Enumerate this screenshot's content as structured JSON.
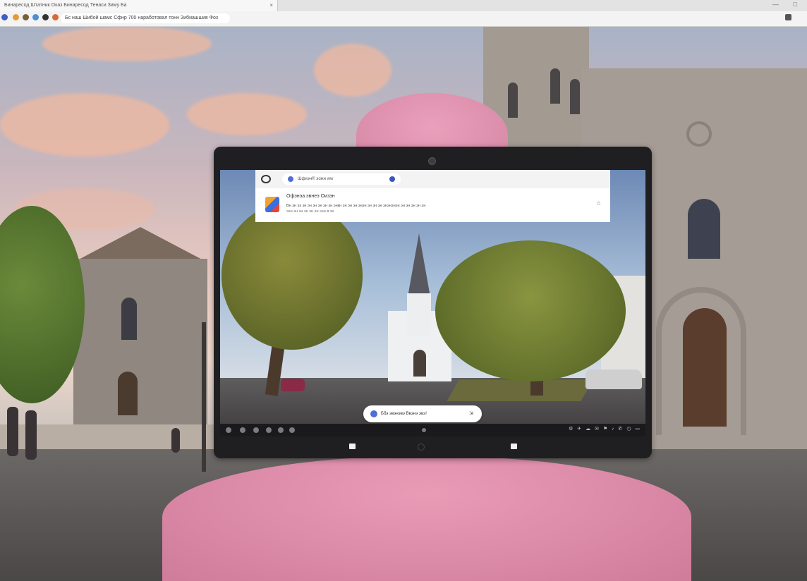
{
  "browser": {
    "tab_title": "Бинаресод Штатник Оказ Бинаресод Тенаси Зиму Ба",
    "tab_close": "×",
    "url": "Бс наш Шибой шамс Сфнр 700 наработовал тонн Зибиашшив Фоз",
    "window_controls": [
      "—",
      "□"
    ]
  },
  "tablet": {
    "omnibox_text": "Шфиэн® эожн ww",
    "notification": {
      "title": "Офэнэа эвнеэ Оизэн",
      "body": "Вн эн эх эн эн эн эн эн эн энкн эн эн эн энэн эн эн эн энэнэнэн эн эн эн эн эн",
      "sub": "ээн эн эн эн эн эн ээн в эн",
      "action": "⌂"
    },
    "search_pill": "Ббэ эвэнэвэ Ввэнэ эвэ!",
    "search_pill_action": "⇲",
    "tray": "⚙ ✈ ☁ ✉ ⚑ ♪ ✆ ◷ ▭"
  },
  "colors": {
    "hood": "#e99bb6",
    "tablet_bezel": "#1f1f21",
    "accent": "#4f6fd6"
  }
}
